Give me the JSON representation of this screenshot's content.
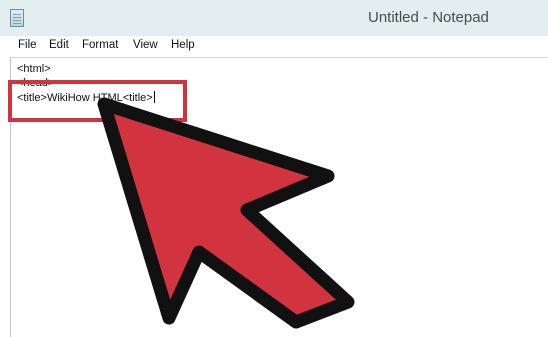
{
  "window": {
    "title": "Untitled - Notepad"
  },
  "menu": {
    "items": [
      {
        "label": "File"
      },
      {
        "label": "Edit"
      },
      {
        "label": "Format"
      },
      {
        "label": "View"
      },
      {
        "label": "Help"
      }
    ]
  },
  "editor": {
    "lines": [
      "<html>",
      "<head>",
      "<title>WikiHow HTML<title>"
    ]
  },
  "icons": {
    "app": "notepad-icon",
    "pointer": "arrow-pointer-icon"
  },
  "colors": {
    "highlight": "#d2343f",
    "arrow_fill": "#d2343f",
    "arrow_outline": "#111111",
    "titlebar": "#e2eef0"
  }
}
